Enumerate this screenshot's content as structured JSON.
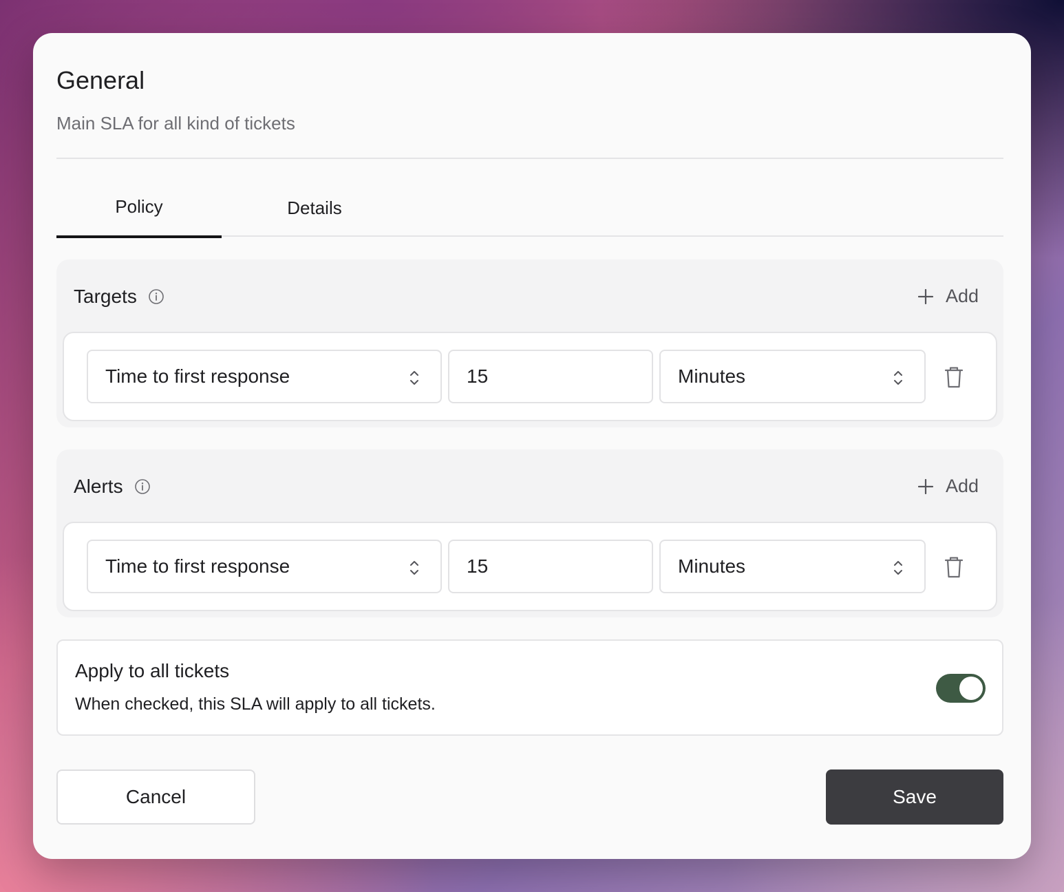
{
  "header": {
    "title": "General",
    "subtitle": "Main SLA for all kind of tickets"
  },
  "tabs": [
    {
      "label": "Policy",
      "active": true
    },
    {
      "label": "Details",
      "active": false
    }
  ],
  "targets": {
    "title": "Targets",
    "add_label": "Add",
    "rows": [
      {
        "metric": "Time to first response",
        "value": "15",
        "unit": "Minutes"
      }
    ]
  },
  "alerts": {
    "title": "Alerts",
    "add_label": "Add",
    "rows": [
      {
        "metric": "Time to first response",
        "value": "15",
        "unit": "Minutes"
      }
    ]
  },
  "apply_all": {
    "title": "Apply to all tickets",
    "description": "When checked, this SLA will apply to all tickets.",
    "enabled": true
  },
  "footer": {
    "cancel_label": "Cancel",
    "save_label": "Save"
  },
  "colors": {
    "toggle_on": "#3e5a44",
    "save_button": "#3c3c40"
  }
}
